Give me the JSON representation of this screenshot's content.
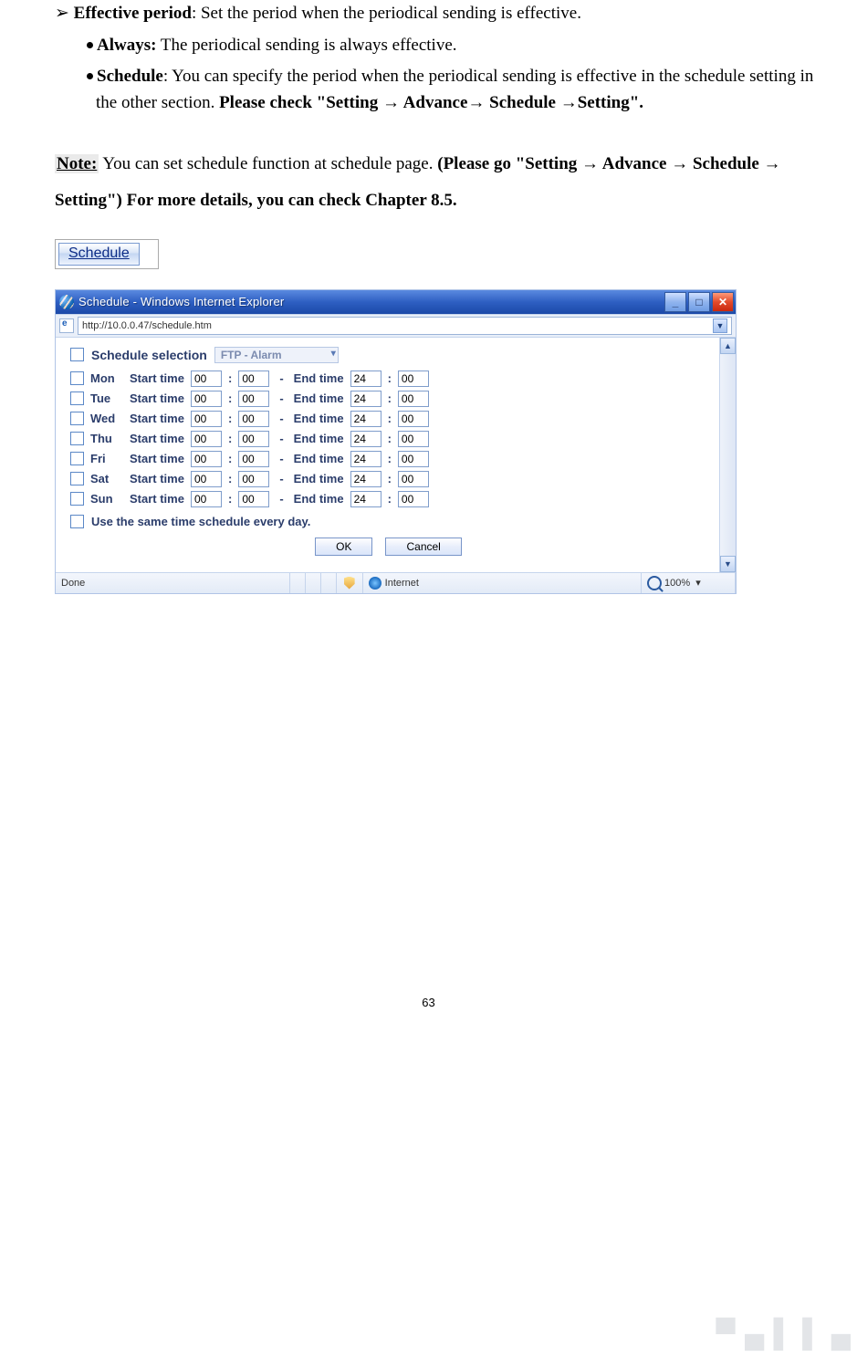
{
  "doc": {
    "bullet1_bold": "Effective period",
    "bullet1_rest": ": Set the period when the periodical sending is effective.",
    "sub1_bold": "Always:",
    "sub1_rest": " The periodical sending is always effective.",
    "sub2_bold": "Schedule",
    "sub2_rest1": ": You can specify the period when the periodical sending is effective in the schedule setting in the other section. ",
    "sub2_bold2": "Please check \"Setting → Advance→ Schedule →Setting\".",
    "note_label": "Note:",
    "note_text1": " You can set schedule function at schedule page. ",
    "note_bold": "(Please go \"Setting → Advance → Schedule → Setting\") For more details, you can check Chapter 8.5.",
    "schedule_btn": "Schedule"
  },
  "ie": {
    "title": "Schedule - Windows Internet Explorer",
    "url": "http://10.0.0.47/schedule.htm",
    "heading": "Schedule selection",
    "select_value": "FTP - Alarm",
    "start_label": "Start time",
    "end_label": "End time",
    "same_label": "Use the same time schedule every day.",
    "ok": "OK",
    "cancel": "Cancel",
    "status_done": "Done",
    "status_zone": "Internet",
    "status_zoom": "100%",
    "days": [
      {
        "day": "Mon",
        "sh": "00",
        "sm": "00",
        "eh": "24",
        "em": "00"
      },
      {
        "day": "Tue",
        "sh": "00",
        "sm": "00",
        "eh": "24",
        "em": "00"
      },
      {
        "day": "Wed",
        "sh": "00",
        "sm": "00",
        "eh": "24",
        "em": "00"
      },
      {
        "day": "Thu",
        "sh": "00",
        "sm": "00",
        "eh": "24",
        "em": "00"
      },
      {
        "day": "Fri",
        "sh": "00",
        "sm": "00",
        "eh": "24",
        "em": "00"
      },
      {
        "day": "Sat",
        "sh": "00",
        "sm": "00",
        "eh": "24",
        "em": "00"
      },
      {
        "day": "Sun",
        "sh": "00",
        "sm": "00",
        "eh": "24",
        "em": "00"
      }
    ]
  },
  "page_number": "63"
}
